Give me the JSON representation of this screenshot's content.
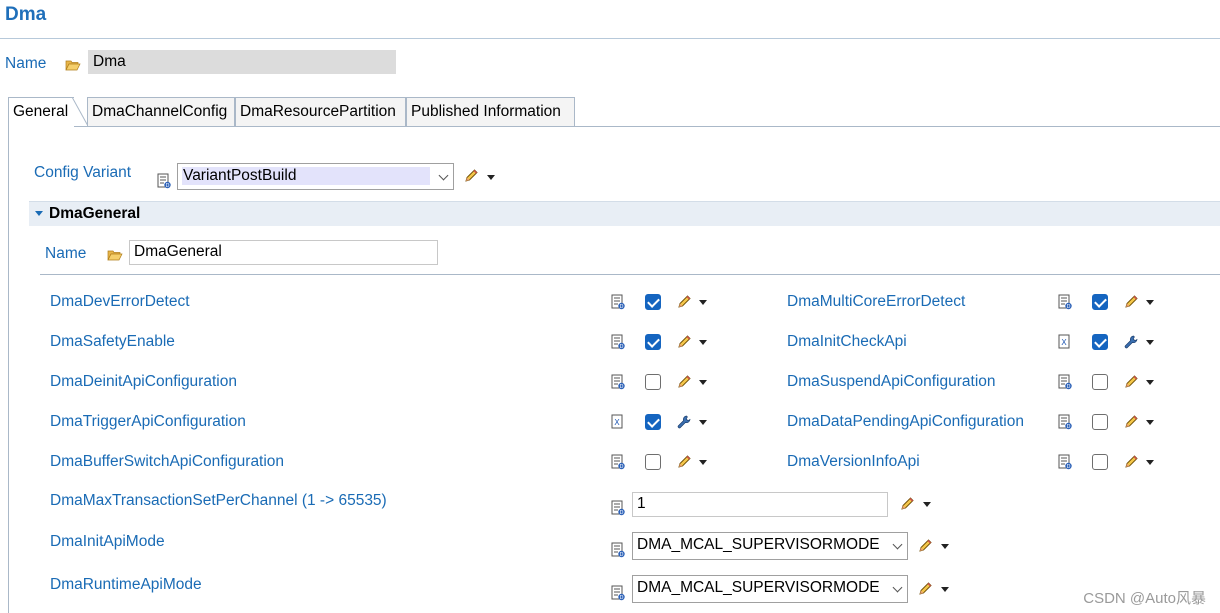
{
  "window": {
    "title": "Dma"
  },
  "header": {
    "name_label": "Name",
    "name_value": "Dma"
  },
  "tabs": [
    {
      "label": "General",
      "active": true
    },
    {
      "label": "DmaChannelConfig",
      "active": false
    },
    {
      "label": "DmaResourcePartition",
      "active": false
    },
    {
      "label": "Published Information",
      "active": false
    }
  ],
  "config_variant": {
    "label": "Config Variant",
    "value": "VariantPostBuild"
  },
  "section": {
    "title": "DmaGeneral",
    "name_label": "Name",
    "name_value": "DmaGeneral"
  },
  "params_left": [
    {
      "label": "DmaDevErrorDetect",
      "checked": true,
      "edit": "pencil"
    },
    {
      "label": "DmaSafetyEnable",
      "checked": true,
      "edit": "pencil"
    },
    {
      "label": "DmaDeinitApiConfiguration",
      "checked": false,
      "edit": "pencil"
    },
    {
      "label": "DmaTriggerApiConfiguration",
      "checked": true,
      "edit": "wrench"
    },
    {
      "label": "DmaBufferSwitchApiConfiguration",
      "checked": false,
      "edit": "pencil"
    }
  ],
  "params_right": [
    {
      "label": "DmaMultiCoreErrorDetect",
      "checked": true,
      "edit": "pencil"
    },
    {
      "label": "DmaInitCheckApi",
      "checked": true,
      "edit": "wrench"
    },
    {
      "label": "DmaSuspendApiConfiguration",
      "checked": false,
      "edit": "pencil"
    },
    {
      "label": "DmaDataPendingApiConfiguration",
      "checked": false,
      "edit": "pencil"
    },
    {
      "label": "DmaVersionInfoApi",
      "checked": false,
      "edit": "pencil"
    }
  ],
  "max_transaction": {
    "label": "DmaMaxTransactionSetPerChannel (1 -> 65535)",
    "value": "1"
  },
  "init_api_mode": {
    "label": "DmaInitApiMode",
    "value": "DMA_MCAL_SUPERVISORMODE"
  },
  "runtime_api_mode": {
    "label": "DmaRuntimeApiMode",
    "value": "DMA_MCAL_SUPERVISORMODE"
  },
  "watermark": "CSDN @Auto风暴",
  "colors": {
    "accent": "#1a6bb5",
    "checkbox_on": "#1565c0",
    "section_bg": "#e8eef5"
  },
  "icons": {
    "folder": "folder-open-icon",
    "doc": "document-icon",
    "pencil": "pencil-icon",
    "wrench": "wrench-icon",
    "dropdown": "caret-down-icon"
  }
}
